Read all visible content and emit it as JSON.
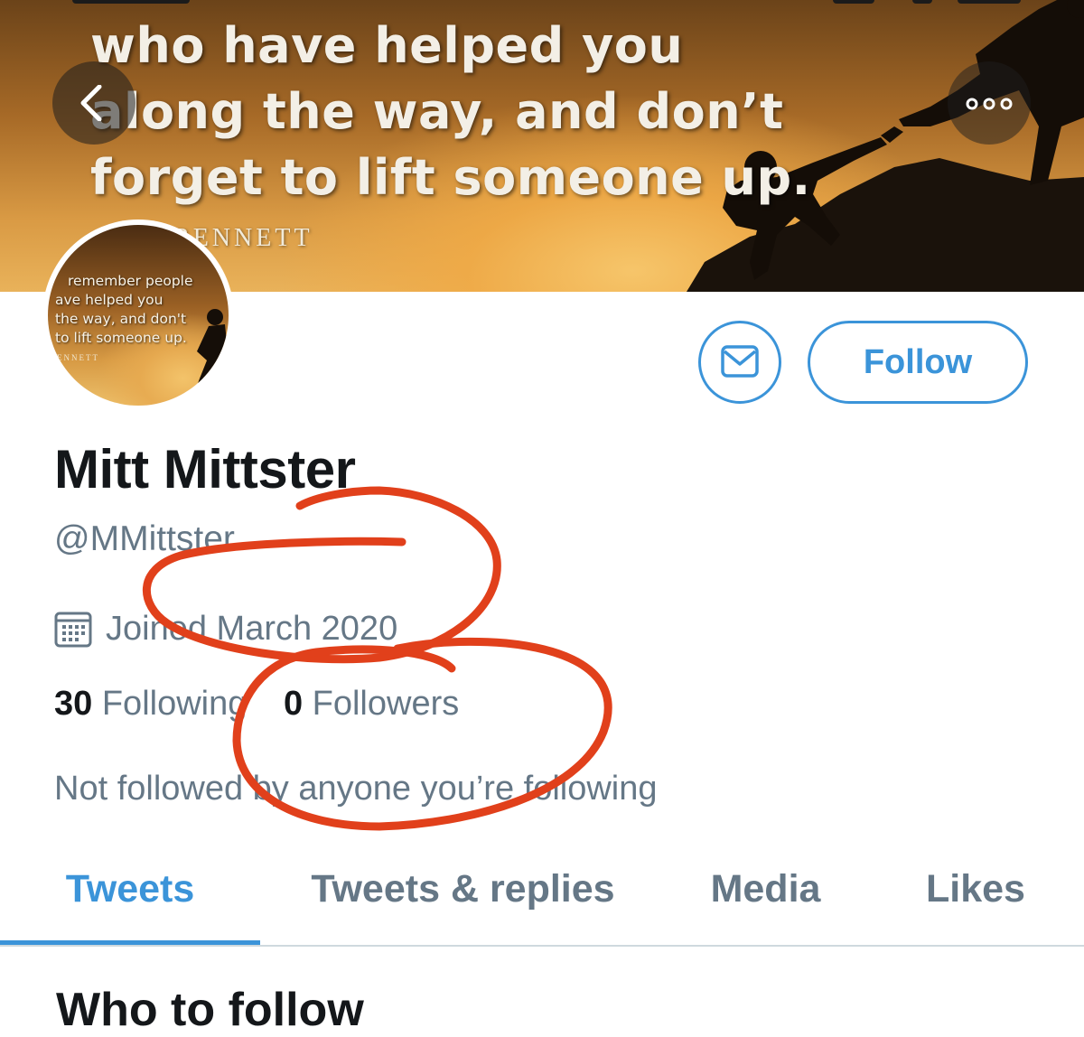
{
  "banner": {
    "quote_lines": [
      "who have helped you",
      "along the way, and don’t",
      "forget to lift someone up."
    ],
    "author": "T. BENNETT"
  },
  "avatar": {
    "quote_lines": [
      "remember people",
      "ave helped you",
      "the way, and don't",
      "to lift someone up."
    ],
    "author": "ENNETT"
  },
  "actions": {
    "follow_label": "Follow"
  },
  "profile": {
    "display_name": "Mitt Mittster",
    "handle": "@MMittster",
    "joined": "Joined March 2020",
    "following_count": "30",
    "following_label": "Following",
    "followers_count": "0",
    "followers_label": "Followers",
    "followed_by": "Not followed by anyone you’re following"
  },
  "tabs": [
    {
      "label": "Tweets",
      "active": true
    },
    {
      "label": "Tweets & replies",
      "active": false
    },
    {
      "label": "Media",
      "active": false
    },
    {
      "label": "Likes",
      "active": false
    }
  ],
  "section": {
    "who_to_follow": "Who to follow"
  },
  "colors": {
    "accent": "#3b94d9",
    "text_primary": "#14171a",
    "text_secondary": "#657786",
    "annotation": "#e1401b"
  },
  "icons": {
    "back": "chevron-left-icon",
    "more": "more-horizontal-icon",
    "message": "envelope-icon",
    "joined": "calendar-icon"
  }
}
